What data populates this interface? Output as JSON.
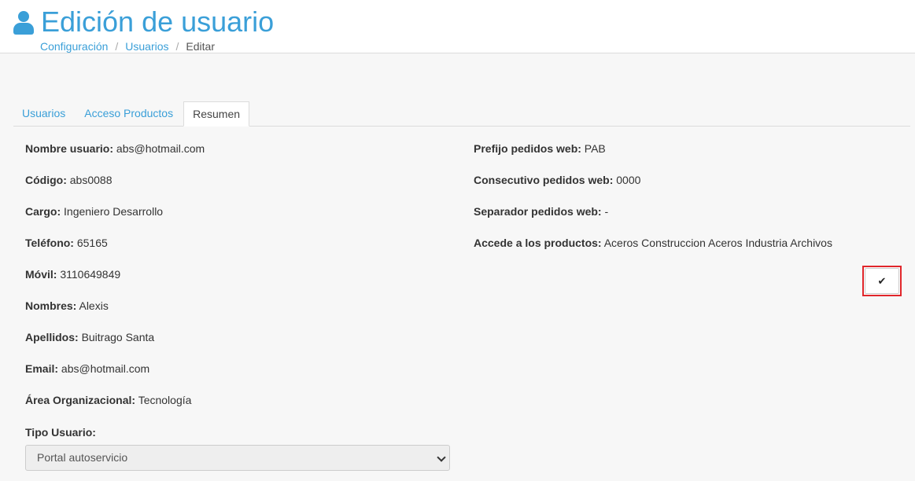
{
  "header": {
    "title": "Edición de usuario",
    "breadcrumb": {
      "item1": "Configuración",
      "sep": "/",
      "item2": "Usuarios",
      "current": "Editar"
    }
  },
  "tabs": {
    "usuarios": "Usuarios",
    "acceso": "Acceso Productos",
    "resumen": "Resumen"
  },
  "left": {
    "nombre_usuario": {
      "label": "Nombre usuario:",
      "value": "abs@hotmail.com"
    },
    "codigo": {
      "label": "Código:",
      "value": "abs0088"
    },
    "cargo": {
      "label": "Cargo:",
      "value": "Ingeniero Desarrollo"
    },
    "telefono": {
      "label": "Teléfono:",
      "value": "65165"
    },
    "movil": {
      "label": "Móvil:",
      "value": "3110649849"
    },
    "nombres": {
      "label": "Nombres:",
      "value": "Alexis"
    },
    "apellidos": {
      "label": "Apellidos:",
      "value": "Buitrago Santa"
    },
    "email": {
      "label": "Email:",
      "value": "abs@hotmail.com"
    },
    "area": {
      "label": "Área Organizacional:",
      "value": "Tecnología"
    },
    "tipo_usuario": {
      "label": "Tipo Usuario:",
      "selected": "Portal autoservicio"
    }
  },
  "right": {
    "prefijo": {
      "label": "Prefijo pedidos web:",
      "value": "PAB"
    },
    "consecutivo": {
      "label": "Consecutivo pedidos web:",
      "value": "0000"
    },
    "separador": {
      "label": "Separador pedidos web:",
      "value": "-"
    },
    "productos": {
      "label": "Accede a los productos:",
      "value": "Aceros Construccion Aceros Industria Archivos"
    }
  },
  "confirm_button": {
    "glyph": "✔",
    "accent": "#e0262b"
  },
  "colors": {
    "primary": "#3a9fd8"
  },
  "icons": {
    "title_icon": "user-icon",
    "button_icon": "check-icon"
  }
}
